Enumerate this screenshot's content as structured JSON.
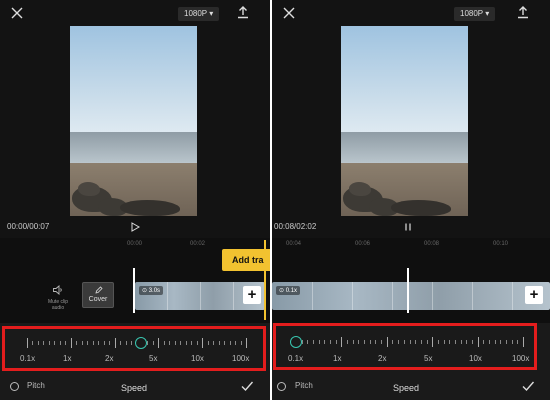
{
  "left": {
    "resolution": "1080P ▾",
    "time": "00:00/00:07",
    "ruler": [
      "00:00",
      "00:02"
    ],
    "mute_label_1": "Mute clip",
    "mute_label_2": "audio",
    "cover_label": "Cover",
    "clip_badge": "⊙ 3.0s",
    "add_track": "Add tra",
    "speed_labels": [
      "0.1x",
      "1x",
      "2x",
      "5x",
      "10x",
      "100x"
    ],
    "speed_value": 0.52,
    "pitch_label": "Pitch",
    "panel_title": "Speed"
  },
  "right": {
    "resolution": "1080P ▾",
    "time": "00:08/02:02",
    "ruler": [
      "00:04",
      "00:06",
      "00:08",
      "00:10"
    ],
    "clip_badge": "⊙ 0.1x",
    "speed_labels": [
      "0.1x",
      "1x",
      "2x",
      "5x",
      "10x",
      "100x"
    ],
    "speed_value": 0.0,
    "pitch_label": "Pitch",
    "panel_title": "Speed"
  },
  "colors": {
    "accent": "#39c6b0",
    "highlight": "#e31d1d",
    "add_track": "#f2c230"
  },
  "icons": {
    "close": "close-icon",
    "export": "export-icon",
    "play": "play-icon",
    "pause": "pause-icon",
    "mute": "speaker-icon",
    "edit": "pencil-icon",
    "plus": "plus-icon",
    "check": "checkmark-icon",
    "pitch": "radio-circle-icon"
  }
}
